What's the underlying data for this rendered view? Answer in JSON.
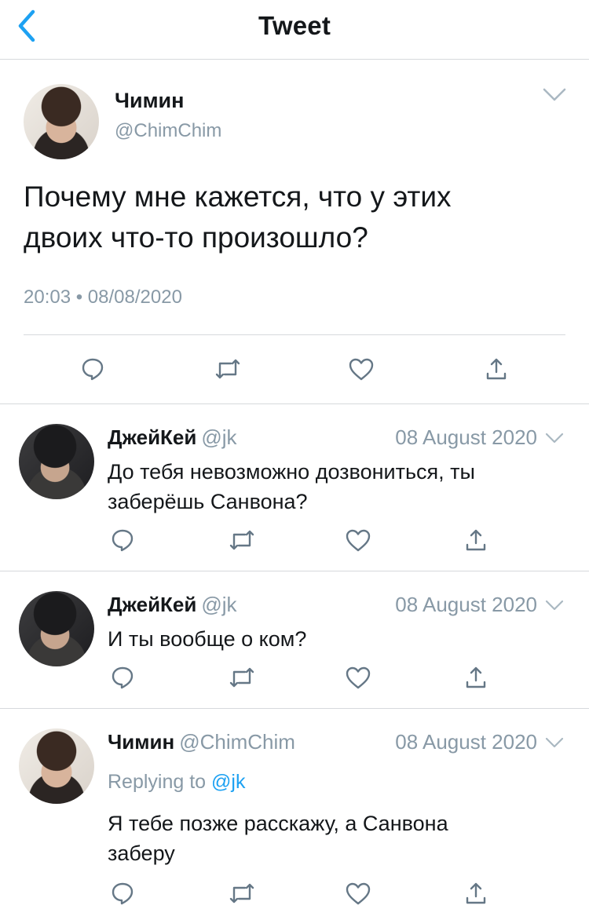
{
  "header": {
    "title": "Tweet",
    "back_icon": "chevron-left-icon",
    "accent": "#1da1f2"
  },
  "main_tweet": {
    "name": "Чимин",
    "handle": "@ChimChim",
    "text_line1": "Почему мне кажется, что у этих",
    "text_line2": "двоих что-то произошло?",
    "timestamp": "20:03 • 08/08/2020"
  },
  "replies": [
    {
      "name": "ДжейКей",
      "handle": "@jk",
      "date": "08 August 2020",
      "text_line1": "До тебя невозможно дозвониться, ты",
      "text_line2": "заберёшь Санвона?"
    },
    {
      "name": "ДжейКей",
      "handle": "@jk",
      "date": "08 August 2020",
      "text_line1": "И ты вообще о ком?"
    },
    {
      "name": "Чимин",
      "handle": "@ChimChim",
      "date": "08 August 2020",
      "replying_prefix": "Replying to",
      "replying_mention": "@jk",
      "text_line1": "Я тебе позже расскажу, а Санвона",
      "text_line2": "заберу"
    }
  ],
  "icons": {
    "reply": "reply-icon",
    "retweet": "retweet-icon",
    "like": "like-icon",
    "share": "share-icon",
    "more": "chevron-down-icon"
  },
  "colors": {
    "text": "#14171a",
    "secondary": "#8899a6",
    "divider": "#d6d9dc",
    "link": "#1da1f2"
  }
}
